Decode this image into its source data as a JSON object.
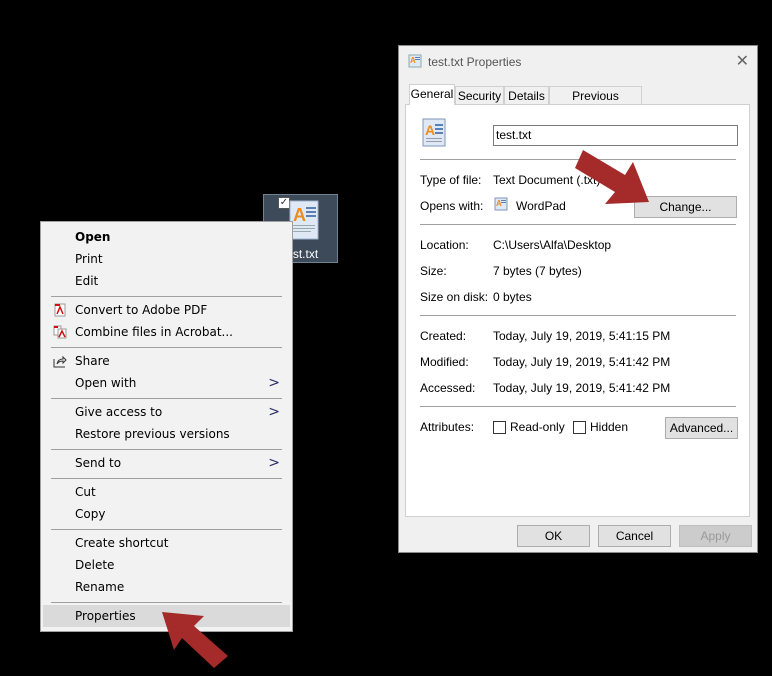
{
  "desktop": {
    "file_icon": {
      "label": "test.txt",
      "icon": "wordpad-document-icon",
      "selected": true,
      "checkbox_checked": true
    }
  },
  "context_menu": {
    "groups": [
      [
        {
          "label": "Open",
          "bold": true
        },
        {
          "label": "Print"
        },
        {
          "label": "Edit"
        }
      ],
      [
        {
          "label": "Convert to Adobe PDF",
          "icon": "adobe-pdf-icon"
        },
        {
          "label": "Combine files in Acrobat...",
          "icon": "acrobat-combine-icon"
        }
      ],
      [
        {
          "label": "Share",
          "icon": "share-icon"
        },
        {
          "label": "Open with",
          "submenu": true
        }
      ],
      [
        {
          "label": "Give access to",
          "submenu": true
        },
        {
          "label": "Restore previous versions"
        }
      ],
      [
        {
          "label": "Send to",
          "submenu": true
        }
      ],
      [
        {
          "label": "Cut"
        },
        {
          "label": "Copy"
        }
      ],
      [
        {
          "label": "Create shortcut"
        },
        {
          "label": "Delete"
        },
        {
          "label": "Rename"
        }
      ],
      [
        {
          "label": "Properties",
          "highlighted": true
        }
      ]
    ]
  },
  "dialog": {
    "title": "test.txt Properties",
    "close_icon": "close-icon",
    "tabs": [
      "General",
      "Security",
      "Details",
      "Previous Versions"
    ],
    "active_tab": "General",
    "general": {
      "file_name": "test.txt",
      "type_of_file_label": "Type of file:",
      "type_of_file": "Text Document (.txt)",
      "opens_with_label": "Opens with:",
      "opens_with": "WordPad",
      "change_button": "Change...",
      "location_label": "Location:",
      "location": "C:\\Users\\Alfa\\Desktop",
      "size_label": "Size:",
      "size": "7 bytes (7 bytes)",
      "size_on_disk_label": "Size on disk:",
      "size_on_disk": "0 bytes",
      "created_label": "Created:",
      "created": "Today, July 19, 2019, 5:41:15 PM",
      "modified_label": "Modified:",
      "modified": "Today, July 19, 2019, 5:41:42 PM",
      "accessed_label": "Accessed:",
      "accessed": "Today, July 19, 2019, 5:41:42 PM",
      "attributes_label": "Attributes:",
      "read_only_label": "Read-only",
      "read_only_checked": false,
      "hidden_label": "Hidden",
      "hidden_checked": false,
      "advanced_button": "Advanced..."
    },
    "buttons": {
      "ok": "OK",
      "cancel": "Cancel",
      "apply": "Apply",
      "apply_disabled": true
    }
  },
  "annotations": {
    "arrow_color": "#a52a2a"
  }
}
